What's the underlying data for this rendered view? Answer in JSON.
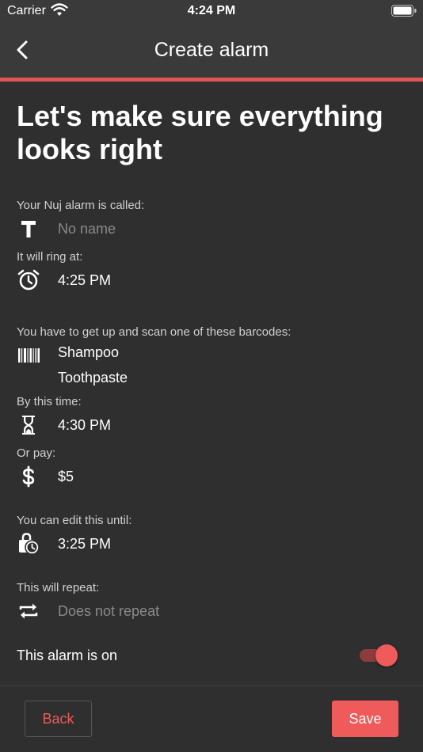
{
  "status_bar": {
    "carrier": "Carrier",
    "time": "4:24 PM"
  },
  "header": {
    "title": "Create alarm",
    "back_icon": "chevron-left-icon"
  },
  "colors": {
    "accent": "#e25555",
    "button": "#ef5a5a",
    "background": "#2f2f2f",
    "header": "#3a3a3a"
  },
  "page": {
    "title": "Let's make sure everything looks right"
  },
  "summary": {
    "name": {
      "label": "Your Nuj alarm is called:",
      "value": "No name",
      "icon": "text-icon"
    },
    "ring": {
      "label": "It will ring at:",
      "value": "4:25 PM",
      "icon": "alarm-clock-icon"
    },
    "barcodes": {
      "label": "You have to get up and scan one of these barcodes:",
      "items": [
        "Shampoo",
        "Toothpaste"
      ],
      "icon": "barcode-icon"
    },
    "deadline": {
      "label": "By this time:",
      "value": "4:30 PM",
      "icon": "hourglass-icon"
    },
    "penalty": {
      "label": "Or pay:",
      "value": "$5",
      "icon": "dollar-icon"
    },
    "edit_until": {
      "label": "You can edit this until:",
      "value": "3:25 PM",
      "icon": "lock-clock-icon"
    },
    "repeat": {
      "label": "This will repeat:",
      "value": "Does not repeat",
      "icon": "repeat-icon"
    }
  },
  "toggle": {
    "label": "This alarm is on",
    "on": true
  },
  "footer": {
    "back_label": "Back",
    "save_label": "Save"
  }
}
